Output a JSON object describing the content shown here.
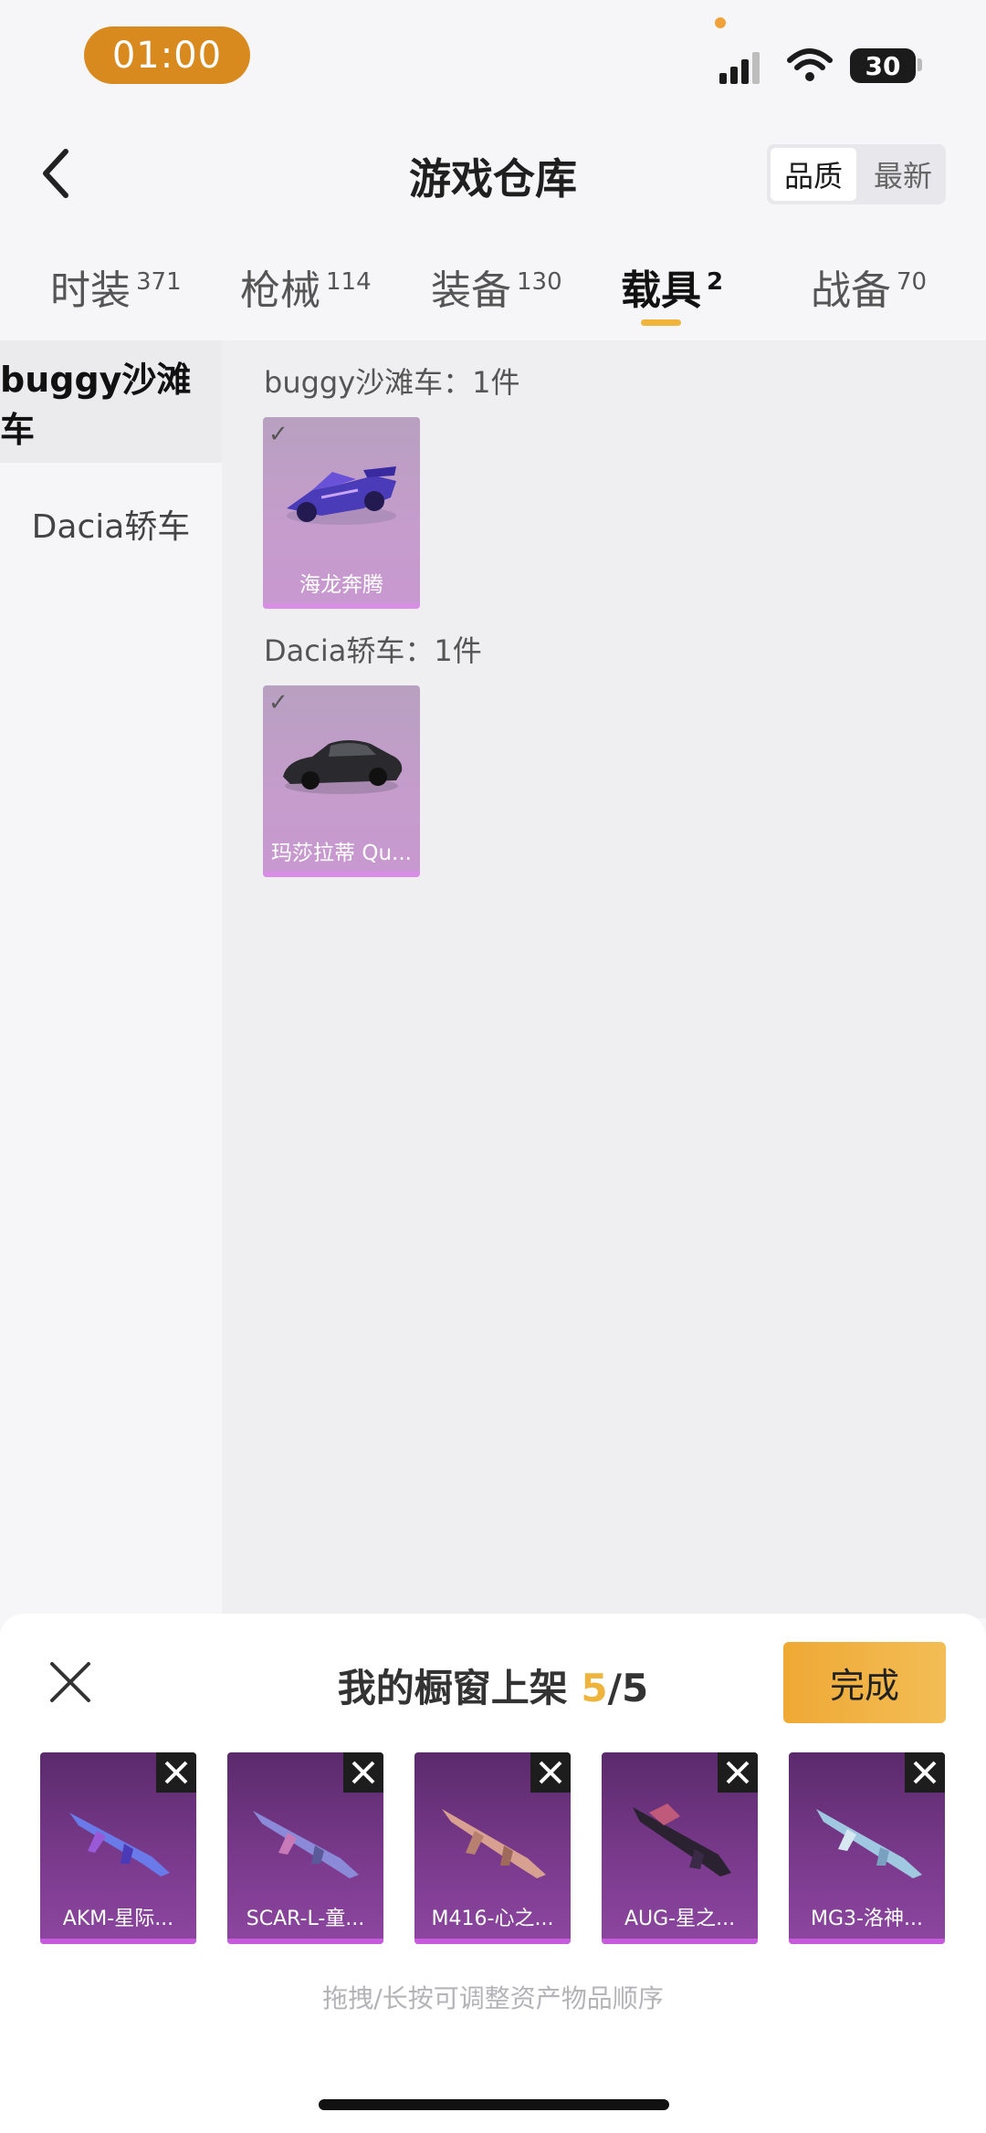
{
  "status": {
    "time": "01:00",
    "battery": "30"
  },
  "header": {
    "title": "游戏仓库",
    "sort_options": [
      "品质",
      "最新"
    ]
  },
  "tabs": [
    {
      "label": "时装",
      "count": "371"
    },
    {
      "label": "枪械",
      "count": "114"
    },
    {
      "label": "装备",
      "count": "130"
    },
    {
      "label": "载具",
      "count": "2"
    },
    {
      "label": "战备",
      "count": "70"
    }
  ],
  "categories": [
    "buggy沙滩车",
    "Dacia轿车"
  ],
  "sections": [
    {
      "title": "buggy沙滩车：1件",
      "items": [
        {
          "name": "海龙奔腾"
        }
      ]
    },
    {
      "title": "Dacia轿车：1件",
      "items": [
        {
          "name": "玛莎拉蒂 Qu..."
        }
      ]
    }
  ],
  "sheet": {
    "title": "我的橱窗上架",
    "count_current": "5",
    "count_total": "/5",
    "done_label": "完成",
    "items": [
      {
        "name": "AKM-星际..."
      },
      {
        "name": "SCAR-L-童..."
      },
      {
        "name": "M416-心之..."
      },
      {
        "name": "AUG-星之..."
      },
      {
        "name": "MG3-洛神..."
      }
    ],
    "hint": "拖拽/长按可调整资产物品顺序"
  },
  "colors": {
    "accent": "#efb43e",
    "card_purple": "#c898d0",
    "shelf_purple": "#7a3a8c"
  }
}
